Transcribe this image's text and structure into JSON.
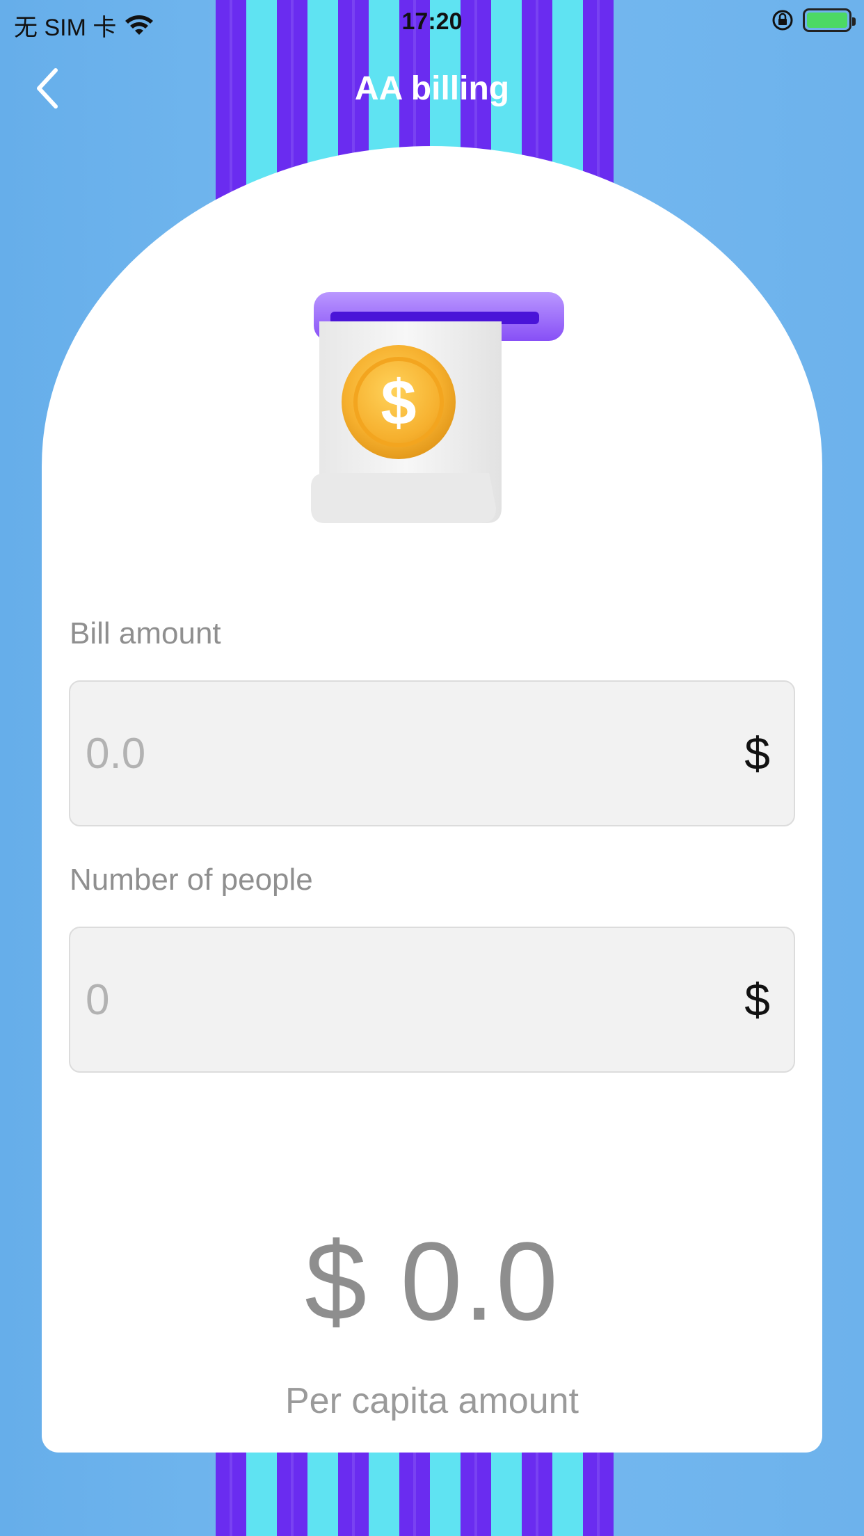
{
  "status_bar": {
    "carrier": "无 SIM 卡",
    "time": "17:20"
  },
  "nav": {
    "title": "AA billing",
    "back_icon": "chevron-left-icon"
  },
  "hero": {
    "icon": "receipt-dollar-icon"
  },
  "form": {
    "bill_amount": {
      "label": "Bill amount",
      "placeholder": "0.0",
      "unit": "$"
    },
    "people": {
      "label": "Number of people",
      "placeholder": "0",
      "unit": "$"
    }
  },
  "result": {
    "amount": "$ 0.0",
    "label": "Per capita amount"
  },
  "colors": {
    "background": "#6eb4ee",
    "stripe_purple": "#6a2cf0",
    "stripe_cyan": "#5fe3f2",
    "card": "#ffffff",
    "field": "#f2f2f2"
  }
}
